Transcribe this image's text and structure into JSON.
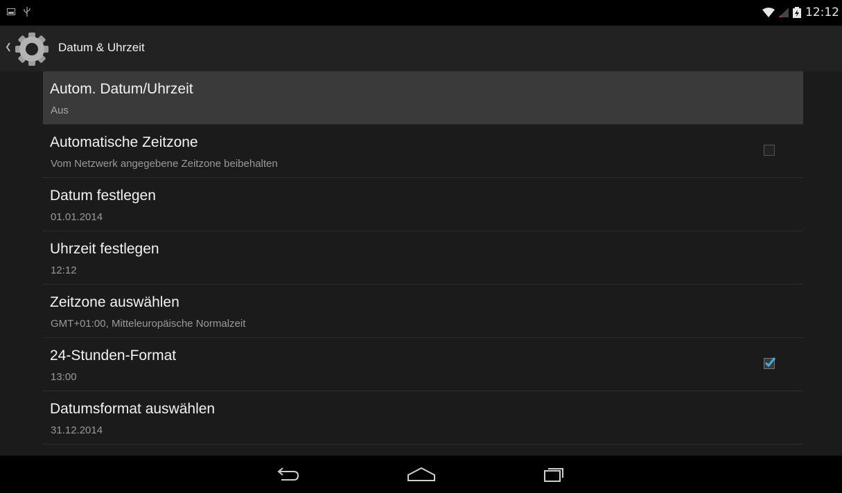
{
  "status_bar": {
    "time": "12:12",
    "icons": [
      "screenshot-icon",
      "usb-icon",
      "wifi-icon",
      "signal-icon",
      "battery-icon"
    ]
  },
  "action_bar": {
    "title": "Datum & Uhrzeit",
    "icon": "settings-gear-icon"
  },
  "settings": [
    {
      "title": "Autom. Datum/Uhrzeit",
      "summary": "Aus"
    },
    {
      "title": "Automatische Zeitzone",
      "summary": "Vom Netzwerk angegebene Zeitzone beibehalten",
      "checkbox": false
    },
    {
      "title": "Datum festlegen",
      "summary": "01.01.2014"
    },
    {
      "title": "Uhrzeit festlegen",
      "summary": "12:12"
    },
    {
      "title": "Zeitzone auswählen",
      "summary": "GMT+01:00, Mitteleuropäische Normalzeit"
    },
    {
      "title": "24-Stunden-Format",
      "summary": "13:00",
      "checkbox": true
    },
    {
      "title": "Datumsformat auswählen",
      "summary": "31.12.2014"
    }
  ],
  "nav_bar": {
    "buttons": [
      "back-icon",
      "home-icon",
      "recent-apps-icon"
    ]
  },
  "colors": {
    "accent": "#33b5e5",
    "background": "#1b1b1b",
    "action_bar": "#222222",
    "selected_row": "#3a3a3a"
  }
}
